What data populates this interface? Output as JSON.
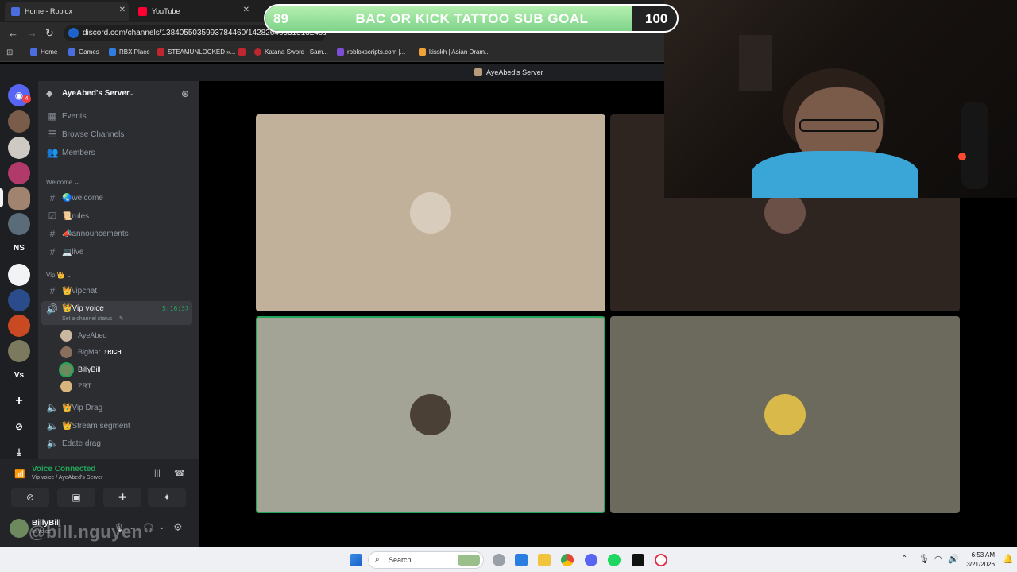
{
  "browser": {
    "tabs": [
      {
        "label": "Home - Roblox",
        "color": "#4a6ee0"
      },
      {
        "label": "YouTube",
        "color": "#ff0033"
      }
    ],
    "url": "discord.com/channels/1384055035993784460/1428264633151324915",
    "bookmarks": [
      {
        "label": "Home",
        "color": "#4a6ee0"
      },
      {
        "label": "Games",
        "color": "#4a6ee0"
      },
      {
        "label": "RBX.Place",
        "color": "#2f7de1"
      },
      {
        "label": "STEAMUNLOCKED »...",
        "color": "#c0262d"
      },
      {
        "label": "",
        "color": "#c0262d"
      },
      {
        "label": "Katana Sword | Sam...",
        "color": "#c0262d"
      },
      {
        "label": "robloxscripts.com |...",
        "color": "#7a4fd6"
      },
      {
        "label": "kisskh | Asian Dram...",
        "color": "#f0a23a"
      }
    ]
  },
  "discord": {
    "window_title": "AyeAbed's Server",
    "server": {
      "name": "AyeAbed's Server"
    },
    "top_items": [
      {
        "label": "Events",
        "icon": "calendar-icon"
      },
      {
        "label": "Browse Channels",
        "icon": "list-icon"
      },
      {
        "label": "Members",
        "icon": "members-icon"
      }
    ],
    "welcome_category": "Welcome",
    "welcome_channels": [
      {
        "label": "🌏welcome"
      },
      {
        "label": "📜rules"
      },
      {
        "label": "📣announcements"
      },
      {
        "label": "💻live"
      }
    ],
    "vip_category": "Vip 👑",
    "vip_text": "👑vipchat",
    "vip_voice": {
      "label": "👑Vip voice",
      "timer": "5:16:37",
      "status": "Set a channel status"
    },
    "voice_users": [
      {
        "name": "AyeAbed",
        "color": "#c9b7a0"
      },
      {
        "name": "BigMar",
        "color": "#8a6e5e",
        "badge": "⚡RICH"
      },
      {
        "name": "BillyBill",
        "color": "#6d8a5f"
      },
      {
        "name": "ZRT",
        "color": "#d8b47e"
      }
    ],
    "other_channels": [
      {
        "label": "👑Vip Drag"
      },
      {
        "label": "👑Stream segment"
      },
      {
        "label": "Edate drag"
      }
    ],
    "voice_panel": {
      "status": "Voice Connected",
      "channel": "Vip voice / AyeAbed's Server"
    },
    "user_bar": {
      "name": "BillyBill",
      "status": "In voice"
    },
    "rail": [
      {
        "color": "#7a5c4a"
      },
      {
        "color": "#cfc9c3"
      },
      {
        "color": "#b23a6a"
      },
      {
        "color": "#a08470"
      },
      {
        "color": "#5a6b7a"
      },
      {
        "text": "NS",
        "color": "#1e1f22"
      },
      {
        "color": "#f2f3f5"
      },
      {
        "color": "#2a4c8a"
      },
      {
        "color": "#c94a22"
      },
      {
        "color": "#7c7a5e"
      },
      {
        "text": "Vs",
        "color": "#1e1f22"
      }
    ]
  },
  "call_tiles": [
    {
      "bg": "#c2b19a",
      "avatar": "#d8cdbd",
      "speaking": false
    },
    {
      "bg": "#2e2420",
      "avatar": "#6b5048",
      "speaking": false
    },
    {
      "bg": "#a3a396",
      "avatar": "#4a4036",
      "speaking": true
    },
    {
      "bg": "#6b6a5c",
      "avatar": "#d9b94a",
      "speaking": false
    }
  ],
  "overlay": {
    "goal_current": "89",
    "goal_label": "BAC OR KICK TATTOO SUB GOAL",
    "goal_target": "100",
    "goal_progress": 0.89,
    "watermark": "@bill.nguyen"
  },
  "taskbar": {
    "search_placeholder": "Search",
    "time": "6:53 AM",
    "date": "3/21/2026"
  }
}
